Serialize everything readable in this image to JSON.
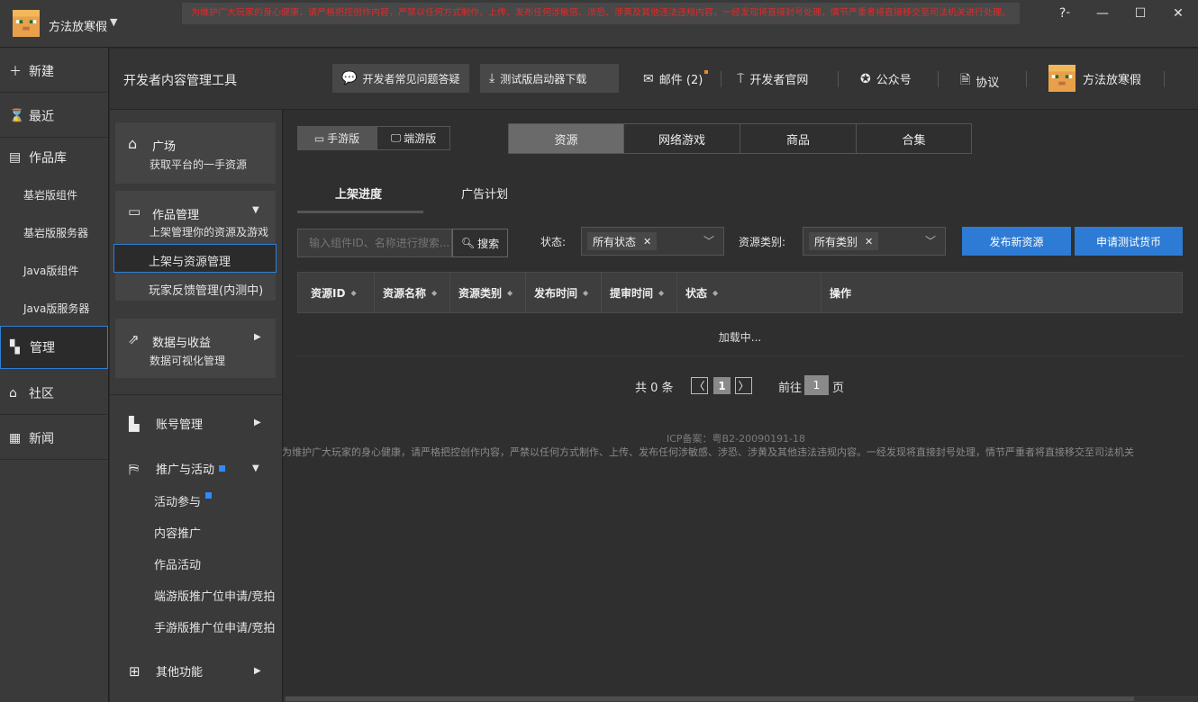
{
  "titlebar": {
    "username": "方法放寒假",
    "banner": "为维护广大玩家的身心健康，请严格把控创作内容，严禁以任何方式制作、上传、发布任何涉敏感、涉恐、涉黄及其他违法违规内容，一经发现将直接封号处理，情节严重者将直接移交至司法机关进行处理。",
    "help": "?",
    "minimize": "—",
    "maximize": "☐",
    "close": "✕"
  },
  "leftnav": {
    "new": "新建",
    "recent": "最近",
    "library": "作品库",
    "bedrock_addon": "基岩版组件",
    "bedrock_server": "基岩版服务器",
    "java_addon": "Java版组件",
    "java_server": "Java版服务器",
    "manage": "管理",
    "community": "社区",
    "news": "新闻"
  },
  "header": {
    "title": "开发者内容管理工具",
    "faq": "开发者常见问题答疑",
    "download": "测试版启动器下载",
    "mail": "邮件 (2)",
    "official": "开发者官网",
    "wechat": "公众号",
    "agreement": "协议",
    "username": "方法放寒假"
  },
  "sidebar": {
    "plaza_title": "广场",
    "plaza_sub": "获取平台的一手资源",
    "works_title": "作品管理",
    "works_sub": "上架管理你的资源及游戏",
    "listing": "上架与资源管理",
    "feedback": "玩家反馈管理(内测中)",
    "data_title": "数据与收益",
    "data_sub": "数据可视化管理",
    "account": "账号管理",
    "promo": "推广与活动",
    "activity": "活动参与",
    "content_promo": "内容推广",
    "work_activity": "作品活动",
    "pc_slot": "端游版推广位申请/竞拍",
    "mobile_slot": "手游版推广位申请/竞拍",
    "other": "其他功能"
  },
  "main": {
    "platform_mobile": "手游版",
    "platform_pc": "端游版",
    "cat_resource": "资源",
    "cat_online": "网络游戏",
    "cat_goods": "商品",
    "cat_collection": "合集",
    "tab_progress": "上架进度",
    "tab_ads": "广告计划",
    "search_placeholder": "输入组件ID、名称进行搜索...",
    "search_btn": "搜索",
    "status_label": "状态:",
    "status_value": "所有状态",
    "category_label": "资源类别:",
    "category_value": "所有类别",
    "publish_btn": "发布新资源",
    "currency_btn": "申请测试货币",
    "columns": [
      "资源ID",
      "资源名称",
      "资源类别",
      "发布时间",
      "提审时间",
      "状态",
      "操作"
    ],
    "loading": "加载中...",
    "total": "共 0 条",
    "page": "1",
    "goto": "前往",
    "goto_value": "1",
    "page_unit": "页",
    "icp": "ICP备案：粤B2-20090191-18",
    "footer_notice": "为维护广大玩家的身心健康，请严格把控创作内容，严禁以任何方式制作、上传、发布任何涉敏感、涉恐、涉黄及其他违法违规内容。一经发现将直接封号处理，情节严重者将直接移交至司法机关"
  }
}
